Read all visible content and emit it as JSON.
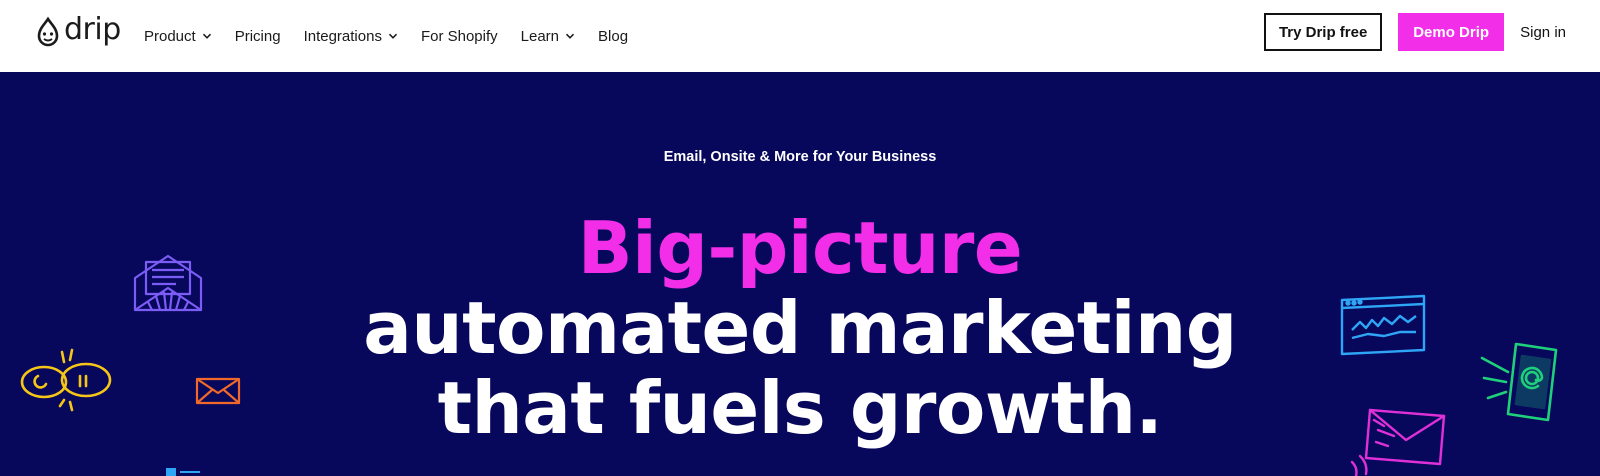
{
  "brand": {
    "name": "drip"
  },
  "nav": {
    "items": [
      {
        "label": "Product",
        "has_dropdown": true
      },
      {
        "label": "Pricing",
        "has_dropdown": false
      },
      {
        "label": "Integrations",
        "has_dropdown": true
      },
      {
        "label": "For Shopify",
        "has_dropdown": false
      },
      {
        "label": "Learn",
        "has_dropdown": true
      },
      {
        "label": "Blog",
        "has_dropdown": false
      }
    ]
  },
  "actions": {
    "try_label": "Try Drip free",
    "demo_label": "Demo Drip",
    "signin_label": "Sign in"
  },
  "hero": {
    "eyebrow": "Email, Onsite & More for Your Business",
    "headline": {
      "line1": "Big-picture",
      "line2": "automated marketing",
      "line3": "that fuels growth."
    }
  },
  "icons": {
    "left": [
      "envelope-newsletter-icon",
      "chat-bubbles-icon",
      "small-envelope-icon"
    ],
    "right": [
      "browser-chart-icon",
      "phone-email-icon",
      "pink-envelope-icon"
    ]
  },
  "colors": {
    "hero_bg": "#07075c",
    "accent_pink": "#f22ee8",
    "header_bg": "#ffffff",
    "text_dark": "#1b1b1b"
  }
}
